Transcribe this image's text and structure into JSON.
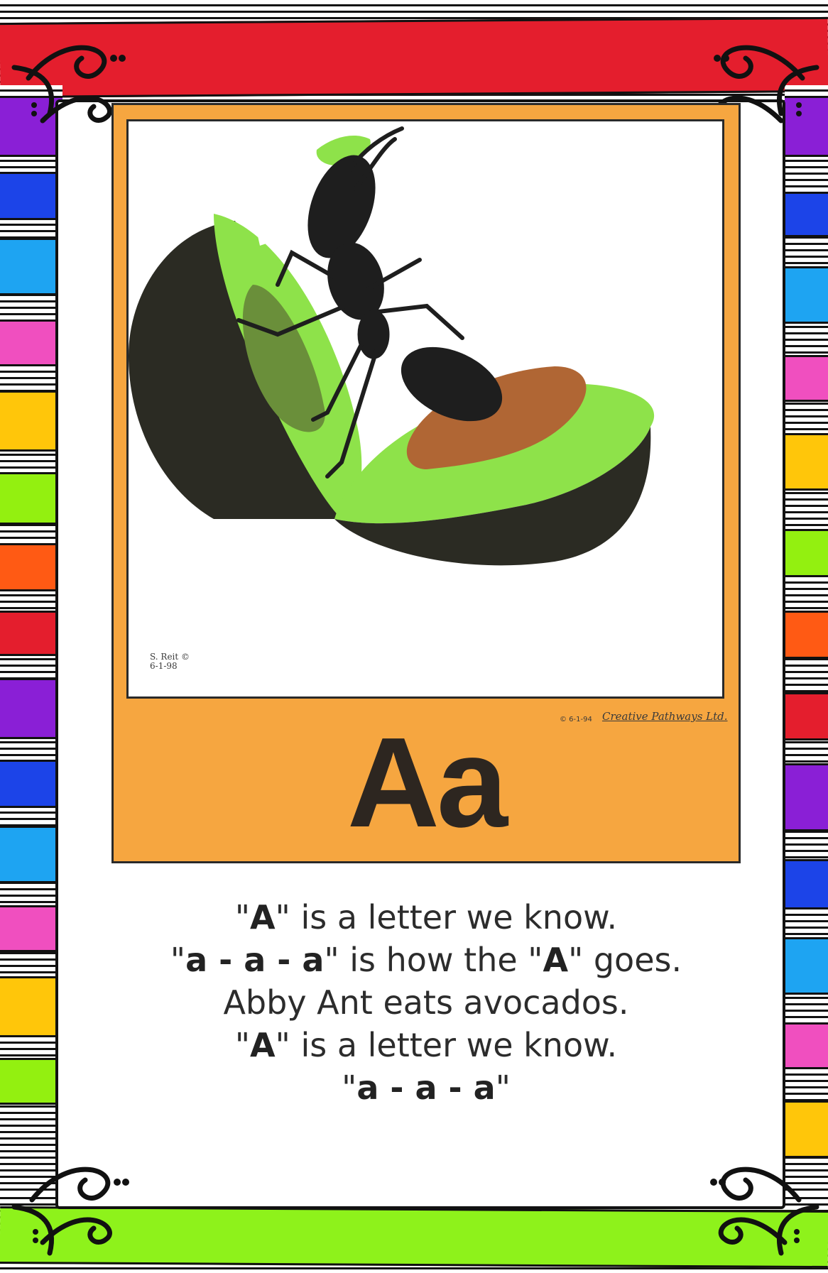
{
  "poster": {
    "letter": "Aa",
    "signature": "S. Reit ©\n6-1-98",
    "copyright": "© 6-1-94",
    "publisher": "Creative Pathways Ltd."
  },
  "rhyme": {
    "line1": {
      "q1": "\"",
      "bold": "A",
      "q2": "\"",
      "rest": " is a letter we know."
    },
    "line2": {
      "q1": "\"",
      "bold": "a - a - a",
      "q2": "\"",
      "mid": " is how the ",
      "q3": "\"",
      "bold2": "A",
      "q4": "\"",
      "rest": " goes."
    },
    "line3": {
      "text": "Abby Ant eats avocados."
    },
    "line4": {
      "q1": "\"",
      "bold": "A",
      "q2": "\"",
      "rest": " is a letter we know."
    },
    "line5": {
      "q1": "\"",
      "bold": "a - a - a",
      "q2": "\""
    }
  },
  "colors": {
    "border_top": "#e41e2d",
    "border_bottom": "#8ef21b",
    "poster_frame": "#f6a640",
    "avocado_flesh": "#8ee24a",
    "avocado_skin": "#2b2b23",
    "pit": "#b06634",
    "ant": "#1e1e1e",
    "side_blocks": [
      "#8a1fd6",
      "#1c44e8",
      "#1ea4f2",
      "#f04fbf",
      "#ffc60a",
      "#93f010",
      "#ff5a14",
      "#e41e2d"
    ]
  },
  "icons": [
    "ant-illustration",
    "avocado-illustration",
    "swirl-corner-icon"
  ]
}
